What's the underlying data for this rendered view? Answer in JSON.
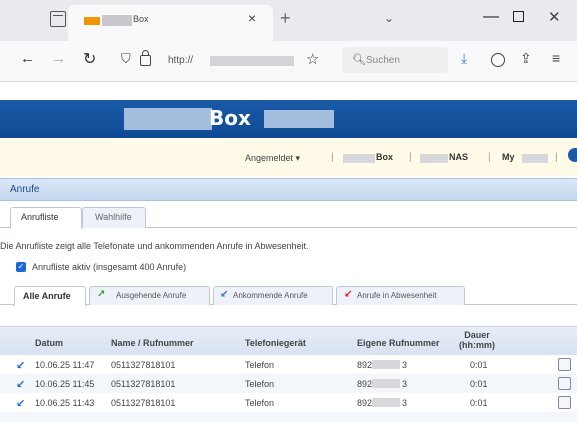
{
  "browser": {
    "tab_title_visible": "Box",
    "tab_close": "×",
    "new_tab": "+",
    "tab_list": "⌄",
    "minimize": "—",
    "close": "✕",
    "url_prefix": "http://",
    "search_placeholder": "Suchen",
    "icons": [
      "tabs-icon",
      "back-icon",
      "forward-icon",
      "reload-icon",
      "shield-icon",
      "lock-icon",
      "star-icon",
      "search-icon",
      "download-icon",
      "account-icon",
      "extensions-icon",
      "menu-icon"
    ]
  },
  "header": {
    "logo_text": "Box",
    "logged_in": "Angemeldet ▾",
    "separator": "|",
    "links": [
      "Box",
      "NAS",
      "My"
    ]
  },
  "section": {
    "title": "Anrufe"
  },
  "subtabs": [
    "Anrufliste",
    "Wahlhilfe"
  ],
  "description": "Die Anrufliste zeigt alle Telefonate und ankommenden Anrufe in Abwesenheit.",
  "checkbox": {
    "label": "Anrufliste aktiv (insgesamt 400 Anrufe)",
    "checked": true,
    "mark": "✓"
  },
  "filter_tabs": [
    {
      "label": "Alle Anrufe",
      "icon": ""
    },
    {
      "label": "Ausgehende Anrufe",
      "icon": "↗"
    },
    {
      "label": "Ankommende Anrufe",
      "icon": "↙"
    },
    {
      "label": "Anrufe in Abwesenheit",
      "icon": "↙"
    }
  ],
  "table": {
    "headers": {
      "datum": "Datum",
      "name": "Name / Rufnummer",
      "telefoniegeraet": "Telefoniegerät",
      "eigene": "Eigene Rufnummer",
      "dauer": "Dauer",
      "dauer_unit": "(hh:mm)"
    },
    "rows": [
      {
        "icon": "↙",
        "datum": "10.06.25 11:47",
        "name": "0511327818101",
        "geraet": "Telefon",
        "eigene_prefix": "892",
        "eigene_suffix": "3",
        "dauer": "0:01"
      },
      {
        "icon": "↙",
        "datum": "10.06.25 11:45",
        "name": "0511327818101",
        "geraet": "Telefon",
        "eigene_prefix": "892",
        "eigene_suffix": "3",
        "dauer": "0:01"
      },
      {
        "icon": "↙",
        "datum": "10.06.25 11:43",
        "name": "0511327818101",
        "geraet": "Telefon",
        "eigene_prefix": "892",
        "eigene_suffix": "3",
        "dauer": "0:01"
      }
    ]
  },
  "colors": {
    "banner": "#1a5aa6",
    "info_bar": "#fffbe8",
    "section_header": "#c3d6ee",
    "outgoing": "#2f9e2f",
    "incoming": "#1d6ad6",
    "missed": "#d52020"
  }
}
